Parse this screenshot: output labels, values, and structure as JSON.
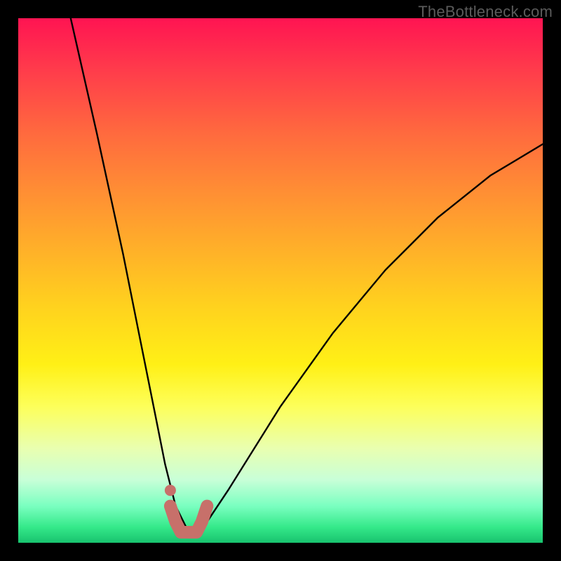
{
  "watermark": "TheBottleneck.com",
  "chart_data": {
    "type": "line",
    "title": "",
    "xlabel": "",
    "ylabel": "",
    "xlim": [
      0,
      100
    ],
    "ylim": [
      0,
      100
    ],
    "grid": false,
    "legend": false,
    "series": [
      {
        "name": "bottleneck-curve",
        "color": "#000000",
        "x": [
          10,
          15,
          20,
          23,
          26,
          28,
          30,
          32,
          34,
          36,
          40,
          45,
          50,
          55,
          60,
          65,
          70,
          75,
          80,
          85,
          90,
          95,
          100
        ],
        "y": [
          100,
          78,
          55,
          40,
          25,
          15,
          7,
          3,
          2,
          4,
          10,
          18,
          26,
          33,
          40,
          46,
          52,
          57,
          62,
          66,
          70,
          73,
          76
        ]
      },
      {
        "name": "highlight-band",
        "color": "#c7706a",
        "x": [
          29,
          30,
          31,
          32,
          33,
          34,
          35,
          36
        ],
        "y": [
          7,
          4,
          2,
          2,
          2,
          2,
          4,
          7
        ]
      },
      {
        "name": "highlight-dot",
        "color": "#c7706a",
        "x": [
          29
        ],
        "y": [
          10
        ]
      }
    ]
  }
}
